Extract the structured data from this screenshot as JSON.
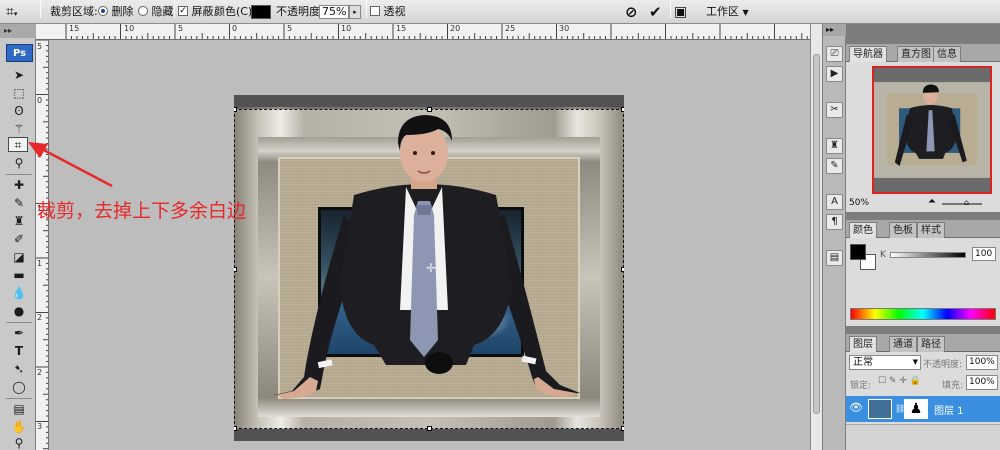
{
  "options_bar": {
    "crop_area_label": "裁剪区域:",
    "delete_label": "删除",
    "hide_label": "隐藏",
    "shield_label": "屏蔽",
    "color_label": "颜色(C):",
    "color_value": "#000000",
    "opacity_label": "不透明度:",
    "opacity_value": "75%",
    "perspective_label": "透视",
    "workspace_label": "工作区"
  },
  "toolbox": {
    "logo": "Ps"
  },
  "rulers": {
    "h_ticks": [
      "15",
      "10",
      "5",
      "0",
      "5",
      "10",
      "15",
      "20",
      "25",
      "30"
    ],
    "v_ticks": [
      "5",
      "0",
      "5",
      "1",
      "1",
      "2",
      "2",
      "3"
    ]
  },
  "annotation": {
    "text": "裁剪，去掉上下多余白边",
    "color": "#e8282a"
  },
  "navigator_panel": {
    "tabs": [
      "导航器",
      "直方图",
      "信息"
    ],
    "zoom": "50%"
  },
  "color_panel": {
    "tabs": [
      "颜色",
      "色板",
      "样式"
    ],
    "channel_label": "K",
    "channel_value": "100"
  },
  "layers_panel": {
    "tabs": [
      "图层",
      "通道",
      "路径"
    ],
    "blend_mode": "正常",
    "opacity_label": "不透明度:",
    "opacity_value": "100%",
    "lock_label": "锁定:",
    "fill_label": "填充:",
    "fill_value": "100%",
    "layer_name": "图层 1"
  },
  "colors": {
    "accent": "#2f6bc4",
    "layer_selected": "#3b8fe0"
  }
}
